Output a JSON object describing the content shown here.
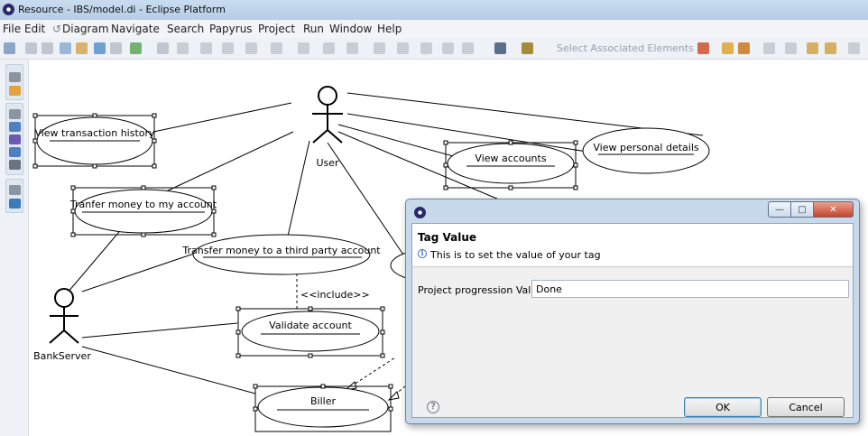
{
  "window": {
    "title": "Resource - IBS/model.di - Eclipse Platform"
  },
  "menu": [
    "File",
    "Edit",
    "Diagram",
    "Navigate",
    "Search",
    "Papyrus",
    "Project",
    "Run",
    "Window",
    "Help"
  ],
  "toolbar": {
    "select_associated": "Select Associated Elements"
  },
  "diagram": {
    "actors": {
      "user": "User",
      "bank_server": "BankServer"
    },
    "use_cases": {
      "view_transaction_history": "View transaction history",
      "view_accounts": "View accounts",
      "view_personal_details": "View personal details",
      "transfer_my_account": "Tranfer money to my account",
      "transfer_third_party": "Transfer money to a third party account",
      "validate_account": "Validate account",
      "biller": "Biller"
    },
    "include_label": "<<include>>"
  },
  "dialog": {
    "header_title": "Tag Value",
    "header_message": "This is to set the value of your tag",
    "field_label": "Project progression Value",
    "field_value": "Done",
    "ok_label": "OK",
    "cancel_label": "Cancel",
    "help_glyph": "?",
    "info_glyph": "i"
  },
  "colors": {
    "titlebar": "#c9dcef",
    "dialog_frame": "#c8d9ec",
    "close_button": "#c4432b"
  }
}
